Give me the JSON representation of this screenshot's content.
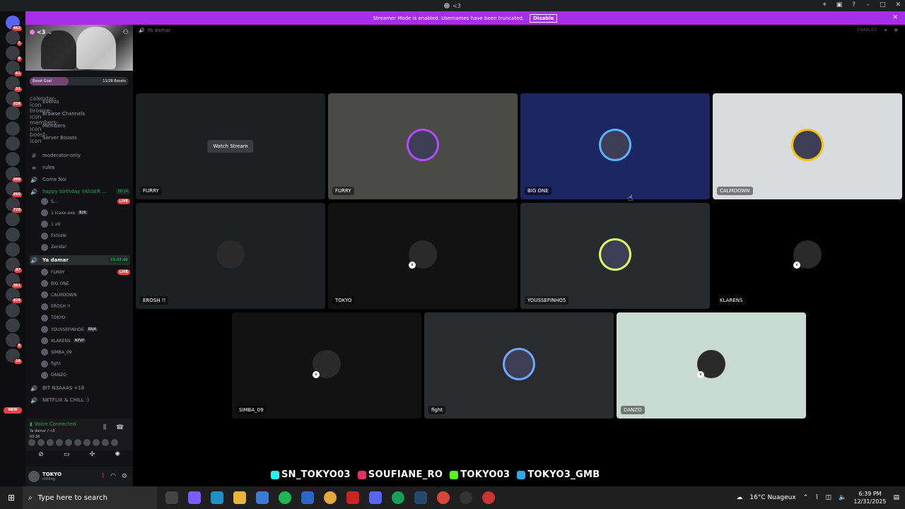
{
  "window": {
    "title": "<3"
  },
  "banner": {
    "text": "Streamer Mode is enabled. Usernames have been truncated.",
    "disable_label": "Disable"
  },
  "server": {
    "name": "<3",
    "boost_label": "Boost Goal",
    "boost_count": "11/28 Boosts",
    "boost_progress": 0.39
  },
  "server_badges": [
    "462",
    "1",
    "9",
    "61",
    "31",
    "338",
    "",
    "",
    "",
    "",
    "290",
    "266",
    "728",
    "",
    "",
    "",
    "87",
    "361",
    "426",
    "",
    "",
    "8",
    "10"
  ],
  "menu": [
    {
      "icon": "calendar-icon",
      "label": "Events"
    },
    {
      "icon": "browse-icon",
      "label": "Browse Channels"
    },
    {
      "icon": "members-icon",
      "label": "Members"
    },
    {
      "icon": "boost-icon",
      "label": "Server Boosts"
    }
  ],
  "channels": [
    {
      "icon": "#",
      "label": "moderator-only"
    },
    {
      "icon": "≡",
      "label": "rules"
    },
    {
      "icon": "🔊",
      "label": "Come Noi"
    },
    {
      "icon": "🔊",
      "label": "happy birthday YASSER ...",
      "time": "58:14"
    }
  ],
  "birthday_users": [
    {
      "name": "S...",
      "live": "LIVE"
    },
    {
      "name": "1 Icaxx.exe",
      "tag": "B2K"
    },
    {
      "name": "1 x9"
    },
    {
      "name": "Extozie"
    },
    {
      "name": "Zeridar"
    }
  ],
  "current_voice": {
    "label": "Ya damar",
    "time": "15:47:46"
  },
  "voice_users": [
    {
      "name": "FURRY",
      "live": "LIVE"
    },
    {
      "name": "BIG ONE"
    },
    {
      "name": "CALMDOWN"
    },
    {
      "name": "EROSH !!"
    },
    {
      "name": "TOKYO"
    },
    {
      "name": "YOUSSEFINHO5",
      "tag": "RAJA"
    },
    {
      "name": "KLARENS",
      "tag": "NPVP"
    },
    {
      "name": "SIMBA_09"
    },
    {
      "name": "fight"
    },
    {
      "name": "DANZO"
    }
  ],
  "channels_after": [
    {
      "icon": "🔊",
      "label": "BIT N3AAAS +18"
    },
    {
      "icon": "🔊",
      "label": "NETFLIX & CHILL :)"
    }
  ],
  "voice_connected": {
    "status": "Voice Connected",
    "channel": "Ya damar / <3",
    "elapsed": "03:36"
  },
  "user": {
    "name": "TOKYO",
    "status": "chilling"
  },
  "main": {
    "channel_title": "Ya damar",
    "header_right": "ENABLED",
    "watch_label": "Watch Stream"
  },
  "tiles": [
    {
      "name": "FURRY",
      "bg": "#1e1f21",
      "watch": true
    },
    {
      "name": "FURRY",
      "bg": "#4a4a46",
      "ring": "#b14cff"
    },
    {
      "name": "BIG ONE",
      "bg": "#1c2660",
      "ring": "#5ab3ff"
    },
    {
      "name": "CALMDOWN",
      "bg": "#d9dcdc",
      "ring": "#f4c10b"
    },
    {
      "name": "EROSH !!",
      "bg": "#1f2021"
    },
    {
      "name": "TOKYO",
      "bg": "#121212",
      "muted": true
    },
    {
      "name": "YOUSSEFINHO5",
      "bg": "#282a2b",
      "ring": "#d7ff6b"
    },
    {
      "name": "KLARENS",
      "bg": "#000000",
      "muted": true
    },
    {
      "name": "SIMBA_09",
      "bg": "#121212",
      "muted": true
    },
    {
      "name": "fight",
      "bg": "#2a2b2e",
      "ring": "#6fa8ff"
    },
    {
      "name": "DANZO",
      "bg": "#c8dad1",
      "muted": true
    }
  ],
  "socials": [
    {
      "name": "SN_TOKYO03",
      "color": "#25f4ee"
    },
    {
      "name": "SOUFIANE_RO",
      "color": "#e1306c"
    },
    {
      "name": "TOKYO03",
      "color": "#53fc18"
    },
    {
      "name": "TOKYO3_GMB",
      "color": "#2aabee"
    }
  ],
  "taskbar": {
    "search_placeholder": "Type here to search",
    "weather": "16°C  Nuageux",
    "time": "6:39 PM",
    "date": "12/31/2025"
  }
}
